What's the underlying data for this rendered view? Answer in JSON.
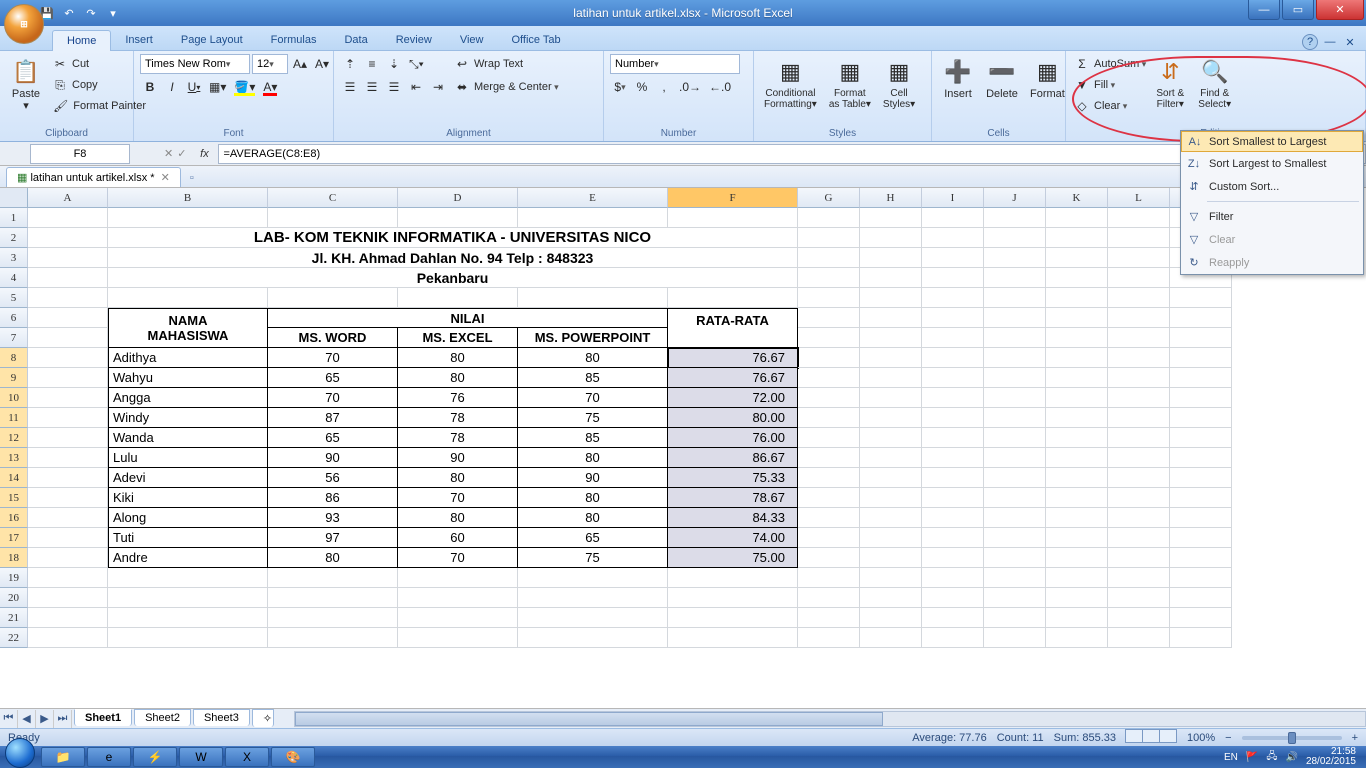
{
  "app": {
    "title": "latihan untuk artikel.xlsx - Microsoft Excel"
  },
  "tabs": {
    "items": [
      "Home",
      "Insert",
      "Page Layout",
      "Formulas",
      "Data",
      "Review",
      "View",
      "Office Tab"
    ],
    "active": 0
  },
  "ribbon": {
    "clipboard": {
      "paste": "Paste",
      "cut": "Cut",
      "copy": "Copy",
      "fmtpaint": "Format Painter",
      "label": "Clipboard"
    },
    "font": {
      "name": "Times New Rom",
      "size": "12",
      "bold": "B",
      "italic": "I",
      "underline": "U",
      "label": "Font"
    },
    "alignment": {
      "wrap": "Wrap Text",
      "merge": "Merge & Center",
      "label": "Alignment"
    },
    "number": {
      "format": "Number",
      "label": "Number"
    },
    "styles": {
      "cond": "Conditional Formatting",
      "fmt": "Format as Table",
      "cell": "Cell Styles",
      "label": "Styles"
    },
    "cells": {
      "insert": "Insert",
      "delete": "Delete",
      "format": "Format",
      "label": "Cells"
    },
    "editing": {
      "autosum": "AutoSum",
      "fill": "Fill",
      "clear": "Clear",
      "sort": "Sort & Filter",
      "find": "Find & Select",
      "label": "Editing"
    }
  },
  "namebox": "F8",
  "formula": "=AVERAGE(C8:E8)",
  "doctab": {
    "name": "latihan untuk artikel.xlsx *"
  },
  "cols": {
    "A": 80,
    "B": 160,
    "C": 130,
    "D": 120,
    "E": 150,
    "F": 130,
    "G": 62,
    "H": 62,
    "I": 62,
    "J": 62,
    "K": 62,
    "L": 62,
    "M": 62
  },
  "header": {
    "l1": "LAB- KOM TEKNIK INFORMATIKA - UNIVERSITAS NICO",
    "l2": "Jl. KH. Ahmad Dahlan No. 94 Telp : 848323",
    "l3": "Pekanbaru"
  },
  "th": {
    "nama": "NAMA MAHASISWA",
    "nilai": "NILAI",
    "word": "MS. WORD",
    "excel": "MS. EXCEL",
    "ppt": "MS. POWERPOINT",
    "rata": "RATA-RATA"
  },
  "rows": [
    {
      "nama": "Adithya",
      "w": "70",
      "e": "80",
      "p": "80",
      "r": "76.67"
    },
    {
      "nama": "Wahyu",
      "w": "65",
      "e": "80",
      "p": "85",
      "r": "76.67"
    },
    {
      "nama": "Angga",
      "w": "70",
      "e": "76",
      "p": "70",
      "r": "72.00"
    },
    {
      "nama": "Windy",
      "w": "87",
      "e": "78",
      "p": "75",
      "r": "80.00"
    },
    {
      "nama": "Wanda",
      "w": "65",
      "e": "78",
      "p": "85",
      "r": "76.00"
    },
    {
      "nama": "Lulu",
      "w": "90",
      "e": "90",
      "p": "80",
      "r": "86.67"
    },
    {
      "nama": "Adevi",
      "w": "56",
      "e": "80",
      "p": "90",
      "r": "75.33"
    },
    {
      "nama": "Kiki",
      "w": "86",
      "e": "70",
      "p": "80",
      "r": "78.67"
    },
    {
      "nama": "Along",
      "w": "93",
      "e": "80",
      "p": "80",
      "r": "84.33"
    },
    {
      "nama": "Tuti",
      "w": "97",
      "e": "60",
      "p": "65",
      "r": "74.00"
    },
    {
      "nama": "Andre",
      "w": "80",
      "e": "70",
      "p": "75",
      "r": "75.00"
    }
  ],
  "menu": {
    "smallest": "Sort Smallest to Largest",
    "largest": "Sort Largest to Smallest",
    "custom": "Custom Sort...",
    "filter": "Filter",
    "clear": "Clear",
    "reapply": "Reapply"
  },
  "status": {
    "ready": "Ready",
    "avg": "Average: 77.76",
    "count": "Count: 11",
    "sum": "Sum: 855.33",
    "zoom": "100%"
  },
  "sheets": [
    "Sheet1",
    "Sheet2",
    "Sheet3"
  ],
  "tray": {
    "lang": "EN",
    "time": "21:58",
    "date": "28/02/2015"
  }
}
